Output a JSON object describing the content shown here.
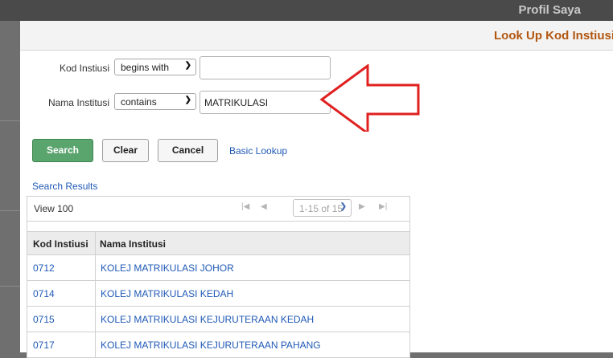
{
  "background": {
    "page_title_partial": "Profil Saya"
  },
  "modal": {
    "title": "Look Up Kod Instiusi",
    "criteria": [
      {
        "label": "Kod Instiusi",
        "operator": "begins with",
        "value": ""
      },
      {
        "label": "Nama Institusi",
        "operator": "contains",
        "value": "MATRIKULASI"
      }
    ],
    "buttons": {
      "search": "Search",
      "clear": "Clear",
      "cancel": "Cancel",
      "basic_lookup": "Basic Lookup"
    },
    "results": {
      "section_label": "Search Results",
      "view_all": "View 100",
      "pager": "1-15 of 15",
      "columns": [
        "Kod Instiusi",
        "Nama Institusi"
      ],
      "rows": [
        [
          "0712",
          "KOLEJ MATRIKULASI JOHOR"
        ],
        [
          "0714",
          "KOLEJ MATRIKULASI KEDAH"
        ],
        [
          "0715",
          "KOLEJ MATRIKULASI KEJURUTERAAN KEDAH"
        ],
        [
          "0717",
          "KOLEJ MATRIKULASI KEJURUTERAAN PAHANG"
        ]
      ]
    }
  },
  "annotation": {
    "arrow_color": "#e02020"
  },
  "colors": {
    "accent_title": "#b2560f",
    "search_button": "#5aa46e",
    "link": "#1f59b6"
  }
}
